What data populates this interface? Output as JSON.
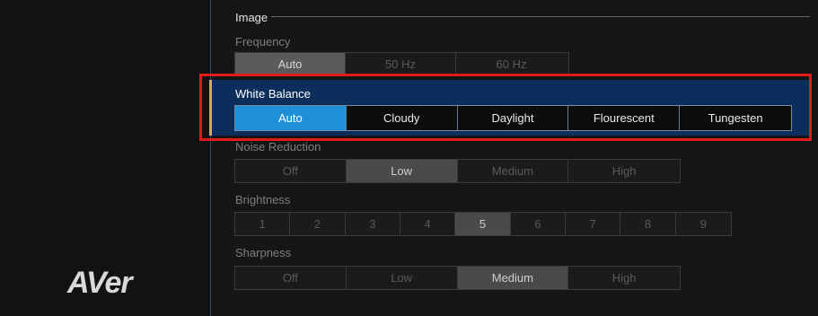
{
  "brand": {
    "logo_text": "AVer"
  },
  "image_group": {
    "title": "Image"
  },
  "frequency": {
    "label": "Frequency",
    "options": [
      "Auto",
      "50 Hz",
      "60 Hz"
    ],
    "selected": "Auto"
  },
  "white_balance": {
    "label": "White Balance",
    "options": [
      "Auto",
      "Cloudy",
      "Daylight",
      "Flourescent",
      "Tungesten"
    ],
    "selected": "Auto"
  },
  "noise_reduction": {
    "label": "Noise Reduction",
    "options": [
      "Off",
      "Low",
      "Medium",
      "High"
    ],
    "selected": "Low"
  },
  "brightness": {
    "label": "Brightness",
    "options": [
      "1",
      "2",
      "3",
      "4",
      "5",
      "6",
      "7",
      "8",
      "9"
    ],
    "selected": "5"
  },
  "sharpness": {
    "label": "Sharpness",
    "options": [
      "Off",
      "Low",
      "Medium",
      "High"
    ],
    "selected": "Medium"
  },
  "colors": {
    "focus_band": "#0c2e5c",
    "selected_accent": "#1e90d8",
    "highlight_box": "#e01b1b",
    "focus_marker": "#c9b24a"
  }
}
